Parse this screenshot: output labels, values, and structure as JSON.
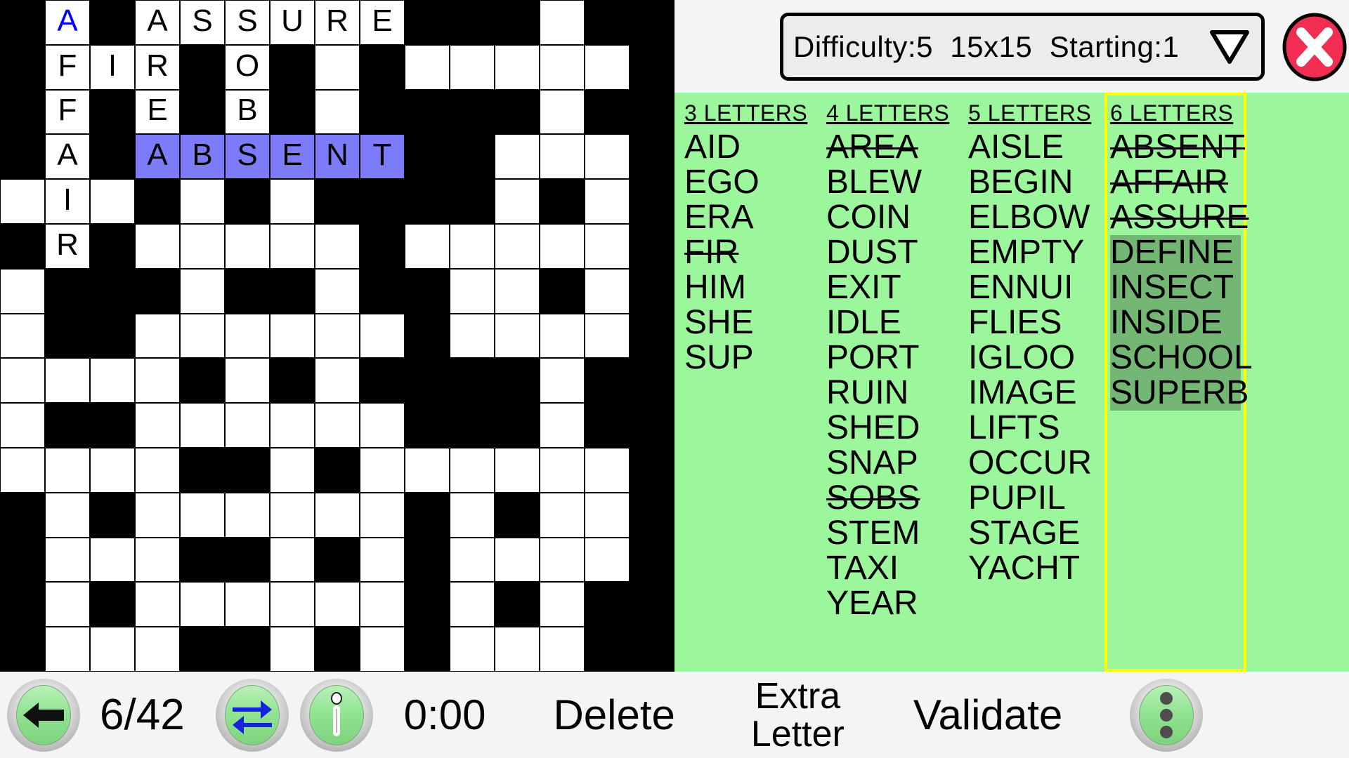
{
  "header": {
    "difficulty_text": "Difficulty:5  15x15  Starting:1",
    "dropdown_icon": "chevron-down-icon",
    "close_icon": "close-x-icon",
    "accent_close": "#f22d52",
    "panel_bg": "#9cf79c",
    "highlight_word_bg": "#74b774",
    "active_border": "#ffff00",
    "selected_cell": "#7c7cfa",
    "cursor_letter_color": "#0000ff"
  },
  "grid": {
    "rows": 15,
    "cols": 15,
    "size_label": "15x15",
    "cells": [
      [
        {
          "t": "b"
        },
        {
          "t": "o",
          "l": "A",
          "c": 1
        },
        {
          "t": "b"
        },
        {
          "t": "o",
          "l": "A"
        },
        {
          "t": "o",
          "l": "S"
        },
        {
          "t": "o",
          "l": "S"
        },
        {
          "t": "o",
          "l": "U"
        },
        {
          "t": "o",
          "l": "R"
        },
        {
          "t": "o",
          "l": "E"
        },
        {
          "t": "b"
        },
        {
          "t": "b"
        },
        {
          "t": "b"
        },
        {
          "t": "o"
        },
        {
          "t": "b"
        },
        {
          "t": "b"
        }
      ],
      [
        {
          "t": "b"
        },
        {
          "t": "o",
          "l": "F"
        },
        {
          "t": "o",
          "l": "I"
        },
        {
          "t": "o",
          "l": "R"
        },
        {
          "t": "b"
        },
        {
          "t": "o",
          "l": "O"
        },
        {
          "t": "b"
        },
        {
          "t": "o"
        },
        {
          "t": "b"
        },
        {
          "t": "o"
        },
        {
          "t": "o"
        },
        {
          "t": "o"
        },
        {
          "t": "o"
        },
        {
          "t": "o"
        },
        {
          "t": "b"
        }
      ],
      [
        {
          "t": "b"
        },
        {
          "t": "o",
          "l": "F"
        },
        {
          "t": "b"
        },
        {
          "t": "o",
          "l": "E"
        },
        {
          "t": "b"
        },
        {
          "t": "o",
          "l": "B"
        },
        {
          "t": "b"
        },
        {
          "t": "o"
        },
        {
          "t": "b"
        },
        {
          "t": "b"
        },
        {
          "t": "b"
        },
        {
          "t": "b"
        },
        {
          "t": "o"
        },
        {
          "t": "b"
        },
        {
          "t": "b"
        }
      ],
      [
        {
          "t": "b"
        },
        {
          "t": "o",
          "l": "A"
        },
        {
          "t": "b"
        },
        {
          "t": "s",
          "l": "A"
        },
        {
          "t": "s",
          "l": "B"
        },
        {
          "t": "s",
          "l": "S"
        },
        {
          "t": "s",
          "l": "E"
        },
        {
          "t": "s",
          "l": "N"
        },
        {
          "t": "s",
          "l": "T"
        },
        {
          "t": "b"
        },
        {
          "t": "b"
        },
        {
          "t": "o"
        },
        {
          "t": "o"
        },
        {
          "t": "o"
        },
        {
          "t": "b"
        }
      ],
      [
        {
          "t": "o"
        },
        {
          "t": "o",
          "l": "I"
        },
        {
          "t": "o"
        },
        {
          "t": "b"
        },
        {
          "t": "o"
        },
        {
          "t": "b"
        },
        {
          "t": "o"
        },
        {
          "t": "b"
        },
        {
          "t": "b"
        },
        {
          "t": "b"
        },
        {
          "t": "b"
        },
        {
          "t": "o"
        },
        {
          "t": "b"
        },
        {
          "t": "o"
        },
        {
          "t": "b"
        }
      ],
      [
        {
          "t": "b"
        },
        {
          "t": "o",
          "l": "R"
        },
        {
          "t": "b"
        },
        {
          "t": "o"
        },
        {
          "t": "o"
        },
        {
          "t": "o"
        },
        {
          "t": "o"
        },
        {
          "t": "o"
        },
        {
          "t": "b"
        },
        {
          "t": "o"
        },
        {
          "t": "o"
        },
        {
          "t": "o"
        },
        {
          "t": "o"
        },
        {
          "t": "o"
        },
        {
          "t": "b"
        }
      ],
      [
        {
          "t": "o"
        },
        {
          "t": "b"
        },
        {
          "t": "b"
        },
        {
          "t": "b"
        },
        {
          "t": "o"
        },
        {
          "t": "b"
        },
        {
          "t": "b"
        },
        {
          "t": "o"
        },
        {
          "t": "b"
        },
        {
          "t": "b"
        },
        {
          "t": "o"
        },
        {
          "t": "o"
        },
        {
          "t": "b"
        },
        {
          "t": "o"
        },
        {
          "t": "b"
        }
      ],
      [
        {
          "t": "o"
        },
        {
          "t": "b"
        },
        {
          "t": "b"
        },
        {
          "t": "o"
        },
        {
          "t": "o"
        },
        {
          "t": "o"
        },
        {
          "t": "o"
        },
        {
          "t": "o"
        },
        {
          "t": "o"
        },
        {
          "t": "b"
        },
        {
          "t": "o"
        },
        {
          "t": "o"
        },
        {
          "t": "o"
        },
        {
          "t": "o"
        },
        {
          "t": "b"
        }
      ],
      [
        {
          "t": "o"
        },
        {
          "t": "o"
        },
        {
          "t": "o"
        },
        {
          "t": "o"
        },
        {
          "t": "b"
        },
        {
          "t": "o"
        },
        {
          "t": "b"
        },
        {
          "t": "o"
        },
        {
          "t": "b"
        },
        {
          "t": "b"
        },
        {
          "t": "b"
        },
        {
          "t": "b"
        },
        {
          "t": "o"
        },
        {
          "t": "b"
        },
        {
          "t": "b"
        }
      ],
      [
        {
          "t": "o"
        },
        {
          "t": "b"
        },
        {
          "t": "b"
        },
        {
          "t": "o"
        },
        {
          "t": "o"
        },
        {
          "t": "o"
        },
        {
          "t": "o"
        },
        {
          "t": "o"
        },
        {
          "t": "o"
        },
        {
          "t": "b"
        },
        {
          "t": "b"
        },
        {
          "t": "b"
        },
        {
          "t": "o"
        },
        {
          "t": "b"
        },
        {
          "t": "b"
        }
      ],
      [
        {
          "t": "o"
        },
        {
          "t": "o"
        },
        {
          "t": "o"
        },
        {
          "t": "o"
        },
        {
          "t": "b"
        },
        {
          "t": "b"
        },
        {
          "t": "o"
        },
        {
          "t": "b"
        },
        {
          "t": "o"
        },
        {
          "t": "o"
        },
        {
          "t": "o"
        },
        {
          "t": "o"
        },
        {
          "t": "o"
        },
        {
          "t": "o"
        },
        {
          "t": "b"
        }
      ],
      [
        {
          "t": "b"
        },
        {
          "t": "o"
        },
        {
          "t": "b"
        },
        {
          "t": "o"
        },
        {
          "t": "o"
        },
        {
          "t": "o"
        },
        {
          "t": "o"
        },
        {
          "t": "o"
        },
        {
          "t": "o"
        },
        {
          "t": "b"
        },
        {
          "t": "o"
        },
        {
          "t": "b"
        },
        {
          "t": "o"
        },
        {
          "t": "o"
        },
        {
          "t": "b"
        }
      ],
      [
        {
          "t": "b"
        },
        {
          "t": "o"
        },
        {
          "t": "o"
        },
        {
          "t": "o"
        },
        {
          "t": "b"
        },
        {
          "t": "b"
        },
        {
          "t": "o"
        },
        {
          "t": "b"
        },
        {
          "t": "o"
        },
        {
          "t": "b"
        },
        {
          "t": "o"
        },
        {
          "t": "o"
        },
        {
          "t": "o"
        },
        {
          "t": "o"
        },
        {
          "t": "b"
        }
      ],
      [
        {
          "t": "b"
        },
        {
          "t": "o"
        },
        {
          "t": "b"
        },
        {
          "t": "o"
        },
        {
          "t": "o"
        },
        {
          "t": "o"
        },
        {
          "t": "o"
        },
        {
          "t": "o"
        },
        {
          "t": "o"
        },
        {
          "t": "b"
        },
        {
          "t": "o"
        },
        {
          "t": "b"
        },
        {
          "t": "o"
        },
        {
          "t": "b"
        },
        {
          "t": "b"
        }
      ],
      [
        {
          "t": "b"
        },
        {
          "t": "o"
        },
        {
          "t": "o"
        },
        {
          "t": "o"
        },
        {
          "t": "b"
        },
        {
          "t": "b"
        },
        {
          "t": "o"
        },
        {
          "t": "b"
        },
        {
          "t": "o"
        },
        {
          "t": "b"
        },
        {
          "t": "o"
        },
        {
          "t": "o"
        },
        {
          "t": "o"
        },
        {
          "t": "b"
        },
        {
          "t": "b"
        }
      ]
    ]
  },
  "word_lists": [
    {
      "heading": "3 LETTERS",
      "active": false,
      "words": [
        {
          "text": "AID",
          "used": false,
          "highlighted": false
        },
        {
          "text": "EGO",
          "used": false,
          "highlighted": false
        },
        {
          "text": "ERA",
          "used": false,
          "highlighted": false
        },
        {
          "text": "FIR",
          "used": true,
          "highlighted": false
        },
        {
          "text": "HIM",
          "used": false,
          "highlighted": false
        },
        {
          "text": "SHE",
          "used": false,
          "highlighted": false
        },
        {
          "text": "SUP",
          "used": false,
          "highlighted": false
        }
      ]
    },
    {
      "heading": "4 LETTERS",
      "active": false,
      "words": [
        {
          "text": "AREA",
          "used": true,
          "highlighted": false
        },
        {
          "text": "BLEW",
          "used": false,
          "highlighted": false
        },
        {
          "text": "COIN",
          "used": false,
          "highlighted": false
        },
        {
          "text": "DUST",
          "used": false,
          "highlighted": false
        },
        {
          "text": "EXIT",
          "used": false,
          "highlighted": false
        },
        {
          "text": "IDLE",
          "used": false,
          "highlighted": false
        },
        {
          "text": "PORT",
          "used": false,
          "highlighted": false
        },
        {
          "text": "RUIN",
          "used": false,
          "highlighted": false
        },
        {
          "text": "SHED",
          "used": false,
          "highlighted": false
        },
        {
          "text": "SNAP",
          "used": false,
          "highlighted": false
        },
        {
          "text": "SOBS",
          "used": true,
          "highlighted": false
        },
        {
          "text": "STEM",
          "used": false,
          "highlighted": false
        },
        {
          "text": "TAXI",
          "used": false,
          "highlighted": false
        },
        {
          "text": "YEAR",
          "used": false,
          "highlighted": false
        }
      ]
    },
    {
      "heading": "5 LETTERS",
      "active": false,
      "words": [
        {
          "text": "AISLE",
          "used": false,
          "highlighted": false
        },
        {
          "text": "BEGIN",
          "used": false,
          "highlighted": false
        },
        {
          "text": "ELBOW",
          "used": false,
          "highlighted": false
        },
        {
          "text": "EMPTY",
          "used": false,
          "highlighted": false
        },
        {
          "text": "ENNUI",
          "used": false,
          "highlighted": false
        },
        {
          "text": "FLIES",
          "used": false,
          "highlighted": false
        },
        {
          "text": "IGLOO",
          "used": false,
          "highlighted": false
        },
        {
          "text": "IMAGE",
          "used": false,
          "highlighted": false
        },
        {
          "text": "LIFTS",
          "used": false,
          "highlighted": false
        },
        {
          "text": "OCCUR",
          "used": false,
          "highlighted": false
        },
        {
          "text": "PUPIL",
          "used": false,
          "highlighted": false
        },
        {
          "text": "STAGE",
          "used": false,
          "highlighted": false
        },
        {
          "text": "YACHT",
          "used": false,
          "highlighted": false
        }
      ]
    },
    {
      "heading": "6 LETTERS",
      "active": true,
      "words": [
        {
          "text": "ABSENT",
          "used": true,
          "highlighted": false
        },
        {
          "text": "AFFAIR",
          "used": true,
          "highlighted": false
        },
        {
          "text": "ASSURE",
          "used": true,
          "highlighted": false
        },
        {
          "text": "DEFINE",
          "used": false,
          "highlighted": true
        },
        {
          "text": "INSECT",
          "used": false,
          "highlighted": true
        },
        {
          "text": "INSIDE",
          "used": false,
          "highlighted": true
        },
        {
          "text": "SCHOOL",
          "used": false,
          "highlighted": true
        },
        {
          "text": "SUPERB",
          "used": false,
          "highlighted": true
        }
      ]
    }
  ],
  "toolbar": {
    "back_icon": "back-arrow-icon",
    "progress": "6/42",
    "swap_icon": "swap-arrows-icon",
    "info_icon": "info-icon",
    "timer": "0:00",
    "delete_label": "Delete",
    "extra_letter_line1": "Extra",
    "extra_letter_line2": "Letter",
    "validate_label": "Validate",
    "menu_icon": "overflow-menu-icon"
  }
}
